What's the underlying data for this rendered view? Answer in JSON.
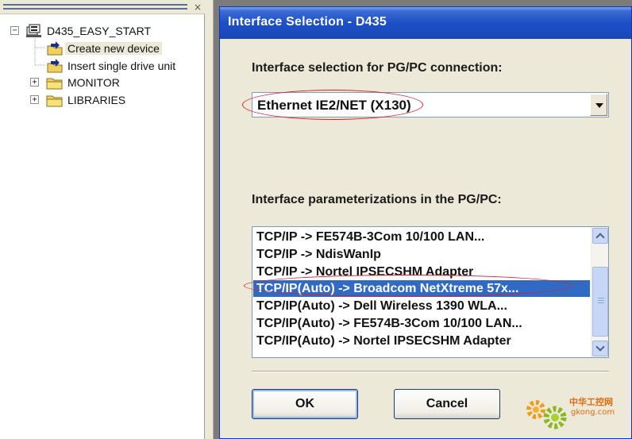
{
  "tree": {
    "close_glyph": "×",
    "root": {
      "label": "D435_EASY_START",
      "expander": "−",
      "icon": "project-icon"
    },
    "children": [
      {
        "label": "Create new device",
        "icon": "wizard-folder-icon",
        "selected": true
      },
      {
        "label": "Insert single drive unit",
        "icon": "wizard-folder-icon"
      },
      {
        "label": "MONITOR",
        "icon": "folder-icon",
        "expander": "+"
      },
      {
        "label": "LIBRARIES",
        "icon": "folder-icon",
        "expander": "+"
      }
    ]
  },
  "dialog": {
    "title": "Interface Selection - D435",
    "connection_label": "Interface selection for PG/PC connection:",
    "connection_value": "Ethernet IE2/NET (X130)",
    "params_label": "Interface parameterizations in the PG/PC:",
    "items": [
      "TCP/IP -> FE574B-3Com 10/100 LAN...",
      "TCP/IP -> NdisWanIp",
      "TCP/IP -> Nortel IPSECSHM Adapter",
      "TCP/IP(Auto) -> Broadcom NetXtreme 57x...",
      "TCP/IP(Auto) -> Dell Wireless 1390 WLA...",
      "TCP/IP(Auto) -> FE574B-3Com 10/100 LAN...",
      "TCP/IP(Auto) -> Nortel IPSECSHM Adapter"
    ],
    "selected_index": 3,
    "ok_label": "OK",
    "cancel_label": "Cancel"
  },
  "watermark": {
    "text": "中华工控网",
    "url": "gkong.com"
  },
  "colors": {
    "selection": "#316ac5",
    "titlebar": "#1c4fc6",
    "annotation": "#d8202a"
  }
}
